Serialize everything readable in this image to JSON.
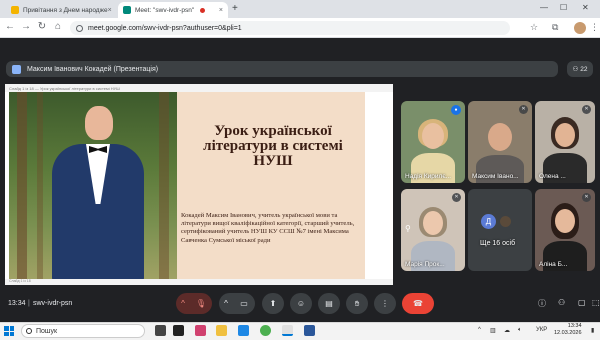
{
  "browser": {
    "tabs": [
      {
        "label": "Привітання з Днем народже",
        "active": false,
        "favicon_color": "#f4b400"
      },
      {
        "label": "Meet: \"swv-ivdr-psn\"",
        "active": true,
        "favicon_color": "#00897b",
        "recording": true
      }
    ],
    "new_tab": "+",
    "url": "meet.google.com/swv-ivdr-psn?authuser=0&pli=1"
  },
  "presentation": {
    "presenter_label": "Максим Іванович Кокадей (Презентація)",
    "participants_count": "22"
  },
  "slide": {
    "window_bar": "Слайд 1 із 18 — Урок української літератури в системі НУШ",
    "title": "Урок української літератури в системі НУШ",
    "body": "Кокадей Максим Іванович, учитель української мови та літератури вищої кваліфікаційної категорії, старший учитель, сертифікований учитель НУШ КУ ССШ №7 імені Максима Савченка Сумської міської ради",
    "status_bar": "Слайд 1 із 18"
  },
  "participants": [
    {
      "name": "Надія Кирилє...",
      "speaking": true
    },
    {
      "name": "Максим Івано...",
      "speaking": false
    },
    {
      "name": "Олена ...",
      "speaking": false
    },
    {
      "name": "Марія Прок...",
      "speaking": false
    },
    {
      "name": "Ще 16 осіб",
      "avatar_letter": "Д"
    },
    {
      "name": "Аліна Б...",
      "speaking": false
    }
  ],
  "meeting": {
    "time": "13:34",
    "code": "swv-ivdr-psn"
  },
  "taskbar": {
    "search_placeholder": "Пошук",
    "lang": "УКР",
    "clock_time": "13:34",
    "clock_date": "12.03.2026"
  },
  "colors": {
    "meet_bg": "#202124",
    "end_call": "#ea4335",
    "mic_off": "#5c2b29",
    "slide_bg": "#f3ddc8",
    "slide_text": "#3b1e14"
  }
}
